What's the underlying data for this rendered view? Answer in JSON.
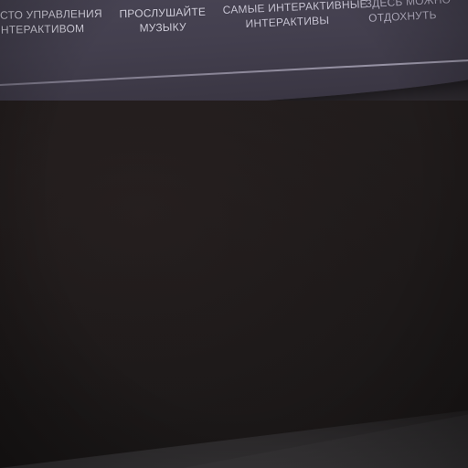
{
  "menu": {
    "items": [
      {
        "line1": "ЕСТО УПРАВЛЕНИЯ",
        "line2": "ИНТЕРАКТИВОМ"
      },
      {
        "line1": "ПРОСЛУШАЙТЕ",
        "line2": "МУЗЫКУ"
      },
      {
        "line1": "САМЫЕ ИНТЕРАКТИВНЫЕ",
        "line2": "ИНТЕРАКТИВЫ"
      },
      {
        "line1": "ЗДЕСЬ МОЖНО",
        "line2": "ОТДОХНУТЬ"
      }
    ]
  },
  "colors": {
    "screen": "#454150",
    "text": "#d9d6e4",
    "wall": "#1e1a1b"
  }
}
